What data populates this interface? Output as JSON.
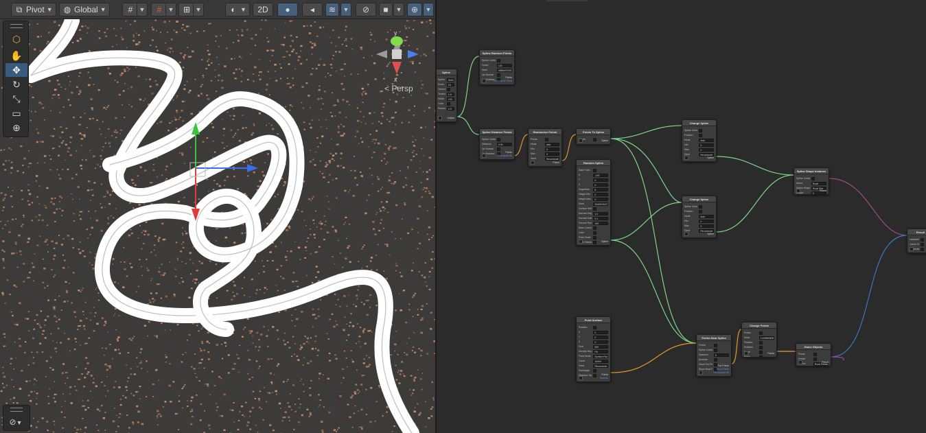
{
  "toolbar": {
    "pivot_label": "Pivot",
    "global_label": "Global",
    "mode_2d_label": "2D"
  },
  "scene": {
    "persp_label": "< Persp",
    "gizmo_axis_y": "y",
    "gizmo_axis_x": "x"
  },
  "colors": {
    "scene_ground": "#3d3b39",
    "path": "#ffffff",
    "gizmo_x": "#3a6ee8",
    "gizmo_y": "#3cc43c",
    "gizmo_z": "#e03a3a",
    "edge_green": "#7dd68a",
    "edge_orange": "#e39a2a",
    "edge_blue": "#3b78c2",
    "edge_purple": "#a04a8a"
  },
  "graph": {
    "nodes": {
      "spline": {
        "title": "Spline",
        "fields": [
          {
            "label": "Spline",
            "value": "Spline Tool"
          },
          {
            "label": "Knots",
            "value": "18"
          },
          {
            "label": "Closed",
            "value": ""
          },
          {
            "label": "Tension",
            "value": "0.5"
          },
          {
            "label": "Width",
            "value": "100"
          },
          {
            "label": "Color",
            "value": ""
          },
          {
            "label": "Resolution",
            "value": "0.5"
          }
        ],
        "output": "Output"
      },
      "spline_random_points": {
        "title": "Spline Random Points",
        "fields": [
          {
            "label": "Spline Container",
            "value": ""
          },
          {
            "label": "Count",
            "value": "100"
          },
          {
            "label": "Seed",
            "value": "4586497035"
          },
          {
            "label": "Up Normal",
            "value": ""
          },
          {
            "label": "Up Rotation",
            "value": ""
          }
        ],
        "output": "Points",
        "output2": "Recompute Seed"
      },
      "spline_distance_points": {
        "title": "Spline Distance Points",
        "fields": [
          {
            "label": "Spline Container",
            "value": ""
          },
          {
            "label": "Distance",
            "value": "0.90"
          },
          {
            "label": "Up Normal",
            "value": ""
          },
          {
            "label": "Up Rotation",
            "value": ""
          }
        ],
        "output": "Points",
        "output2": "Recompute All"
      },
      "randomize_points": {
        "title": "Randomize Points",
        "fields": [
          {
            "label": "Points",
            "value": ""
          },
          {
            "label": "Mode",
            "value": "Add"
          },
          {
            "label": "Min",
            "value": "0"
          },
          {
            "label": "Max",
            "value": "0"
          },
          {
            "label": "Seed",
            "value": "Recompute"
          }
        ],
        "output": "Points"
      },
      "points_to_spline": {
        "title": "Points To Spline",
        "fields": [
          {
            "label": "Points",
            "value": ""
          }
        ],
        "output": "Spline"
      },
      "random_spline": {
        "title": "Random Spline",
        "fields": [
          {
            "label": "Start Point",
            "value": ""
          },
          {
            "label": "X",
            "value": "-100"
          },
          {
            "label": "Y",
            "value": "0"
          },
          {
            "label": "Z",
            "value": "0"
          },
          {
            "label": "Segments",
            "value": "8"
          },
          {
            "label": "Height Min",
            "value": "0"
          },
          {
            "label": "Height Max",
            "value": "0"
          },
          {
            "label": "Seed",
            "value": "2049519475"
          },
          {
            "label": "Surface Settings",
            "value": ""
          },
          {
            "label": "Normal Height",
            "value": "1.0"
          },
          {
            "label": "Normal Noise",
            "value": "0.1"
          },
          {
            "label": "Second Point",
            "value": "100"
          },
          {
            "label": "Base Contour",
            "value": ""
          },
          {
            "label": "Color",
            "value": ""
          },
          {
            "label": "Point Scale",
            "value": ""
          },
          {
            "label": "Base Handle",
            "value": ""
          },
          {
            "label": "Base Shape",
            "value": ""
          }
        ],
        "output": "Spline"
      },
      "change_spline_1": {
        "title": "Change Spline",
        "fields": [
          {
            "label": "Spline Container",
            "value": ""
          },
          {
            "label": "Position",
            "value": ""
          },
          {
            "label": "Mode",
            "value": "Add"
          },
          {
            "label": "Min",
            "value": "0"
          },
          {
            "label": "Max",
            "value": "0"
          },
          {
            "label": "Seed",
            "value": "Recompute"
          }
        ],
        "output": "Spline"
      },
      "change_spline_2": {
        "title": "Change Spline",
        "fields": [
          {
            "label": "Spline Container",
            "value": ""
          },
          {
            "label": "Position",
            "value": ""
          },
          {
            "label": "Mode",
            "value": "Add"
          },
          {
            "label": "Min",
            "value": "0"
          },
          {
            "label": "Max",
            "value": "0"
          },
          {
            "label": "Seed",
            "value": "Recompute"
          }
        ],
        "output": "Spline"
      },
      "spline_shape_instance": {
        "title": "Spline Shape Instance",
        "fields": [
          {
            "label": "Spline Container",
            "value": ""
          },
          {
            "label": "Name",
            "value": "Road"
          },
          {
            "label": "Spline Shape",
            "value": "Road Shp"
          },
          {
            "label": "Height",
            "value": "0"
          }
        ],
        "output": "Result"
      },
      "result": {
        "title": "Result",
        "fields": [
          {
            "label": "Instances",
            "value": ""
          },
          {
            "label": "Game Objects",
            "value": ""
          },
          {
            "label": "Generate",
            "value": ""
          },
          {
            "label": "Clear",
            "value": ""
          }
        ],
        "output": ""
      },
      "point_surface": {
        "title": "Point Surface",
        "fields": [
          {
            "label": "Position",
            "value": ""
          },
          {
            "label": "X",
            "value": "0"
          },
          {
            "label": "Y",
            "value": "0"
          },
          {
            "label": "Z",
            "value": "0"
          },
          {
            "label": "Size",
            "value": "500"
          },
          {
            "label": "Density Mode",
            "value": "Fill"
          },
          {
            "label": "Point Mode",
            "value": "Surface Rand"
          },
          {
            "label": "Count",
            "value": "10000"
          },
          {
            "label": "Seed",
            "value": "Recompute"
          },
          {
            "label": "Shrinkage",
            "value": ""
          },
          {
            "label": "Distance Optimize",
            "value": ""
          }
        ],
        "output": "Points",
        "output2": "Bounds"
      },
      "points_near_spline": {
        "title": "Points Near Spline",
        "fields": [
          {
            "label": "Points",
            "value": ""
          },
          {
            "label": "Spline Container",
            "value": ""
          },
          {
            "label": "Distance",
            "value": "5"
          },
          {
            "label": "Boolean",
            "value": ""
          },
          {
            "label": "Show Far Pts",
            "value": ""
          },
          {
            "label": "Show Near Pts",
            "value": ""
          }
        ],
        "output": "Far Points",
        "output2": "Near Points",
        "output3": "Recompute All"
      },
      "change_points": {
        "title": "Change Points",
        "fields": [
          {
            "label": "Points",
            "value": ""
          },
          {
            "label": "Seed",
            "value": "1449560838"
          },
          {
            "label": "Position",
            "value": ""
          },
          {
            "label": "Rotation",
            "value": ""
          },
          {
            "label": "Scale",
            "value": ""
          },
          {
            "label": "Noise",
            "value": ""
          }
        ],
        "output": "Points"
      },
      "game_objects": {
        "title": "Game Objects",
        "fields": [
          {
            "label": "Points",
            "value": ""
          },
          {
            "label": "Prefab",
            "value": ""
          },
          {
            "label": "Parent",
            "value": "Rock Prefab"
          }
        ],
        "output": "Result"
      }
    }
  }
}
